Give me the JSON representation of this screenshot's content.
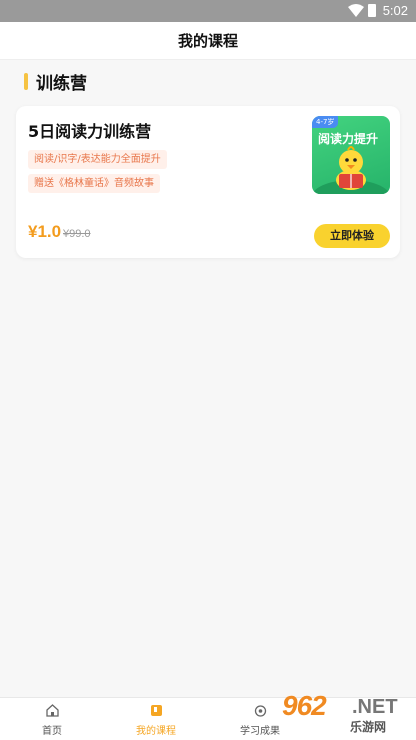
{
  "status_bar": {
    "time": "5:02",
    "wifi_icon": "wifi-icon",
    "battery_icon": "battery-icon"
  },
  "header": {
    "title": "我的课程"
  },
  "section": {
    "title": "训练营",
    "accent_color": "#f6c342"
  },
  "course": {
    "name": "5日阅读力训练营",
    "tags": [
      "阅读/识字/表达能力全面提升",
      "赠送《格林童话》音频故事"
    ],
    "thumbnail": {
      "age_badge": "4-7岁",
      "title": "阅读力提升"
    },
    "price": "¥1.0",
    "original_price": "¥99.0",
    "cta_label": "立即体验",
    "cta_color": "#f9d22e",
    "price_color": "#f39c1e"
  },
  "tabbar": {
    "active_color": "#f5a623",
    "items": [
      {
        "label": "首页",
        "icon": "home-icon"
      },
      {
        "label": "我的课程",
        "icon": "course-book-icon"
      },
      {
        "label": "学习成果",
        "icon": "achievement-icon"
      }
    ]
  },
  "watermark": {
    "number": "962",
    "suffix": ".NET",
    "text": "乐游网"
  }
}
